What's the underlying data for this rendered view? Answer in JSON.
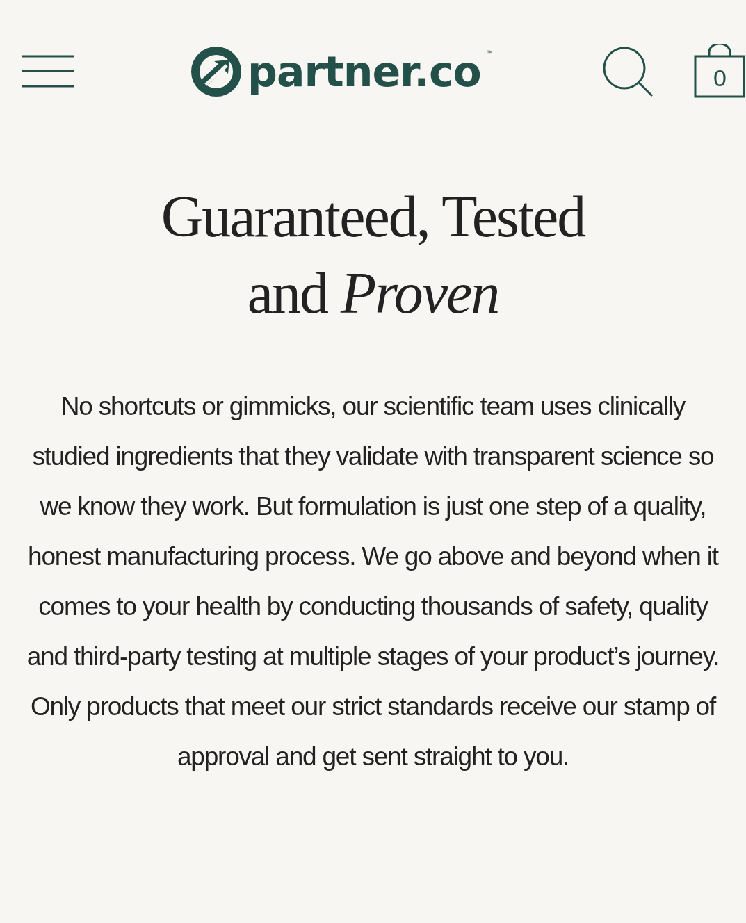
{
  "header": {
    "logo_text": "partner.co",
    "trademark": "™",
    "cart_count": "0"
  },
  "heading": [
    "Guaranteed, Tested",
    "and *Proven*"
  ],
  "body": "No shortcuts or gimmicks, our scientific team uses clinically studied ingredients that they validate with transparent science so we know they work. But formulation is just one step of a quality, honest manufacturing process. We go above and beyond when it comes to your health by conducting thousands of safety, quality and third-party testing at multiple stages of your product’s journey. Only products that meet our strict standards receive our stamp of approval and get sent straight to you."
}
